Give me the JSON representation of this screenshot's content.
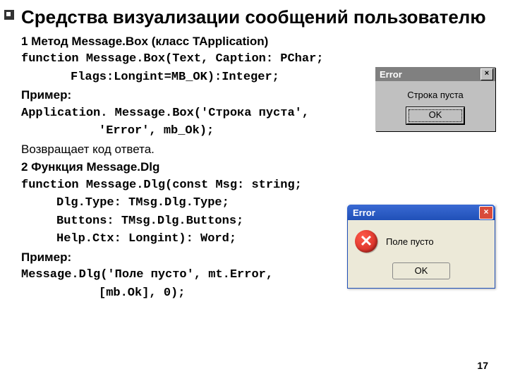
{
  "title": "Средства визуализации сообщений пользователю",
  "section1": {
    "heading": "1 Метод Message.Box (класс TApplication)",
    "decl1": "function Message.Box(Text, Caption: PChar;",
    "decl2": "Flags:Longint=MB_OK):Integer;",
    "example_label": "Пример:",
    "ex1": "Application. Message.Box('Строка пуста',",
    "ex2": "'Error', mb_Ok);",
    "returns": "Возвращает код ответа."
  },
  "section2": {
    "heading": "2 Функция Message.Dlg",
    "decl1": "function Message.Dlg(const Msg: string;",
    "decl2": "Dlg.Type: TMsg.Dlg.Type;",
    "decl3": "Buttons: TMsg.Dlg.Buttons;",
    "decl4": "Help.Ctx: Longint): Word;",
    "example_label": "Пример:",
    "ex1": "Message.Dlg('Поле пусто', mt.Error,",
    "ex2": "[mb.Ok], 0);"
  },
  "dialog1": {
    "title": "Error",
    "message": "Строка пуста",
    "ok": "OK",
    "close": "×"
  },
  "dialog2": {
    "title": "Error",
    "message": "Поле пусто",
    "ok": "OK",
    "close": "×",
    "icon_glyph": "✕"
  },
  "page_number": "17"
}
